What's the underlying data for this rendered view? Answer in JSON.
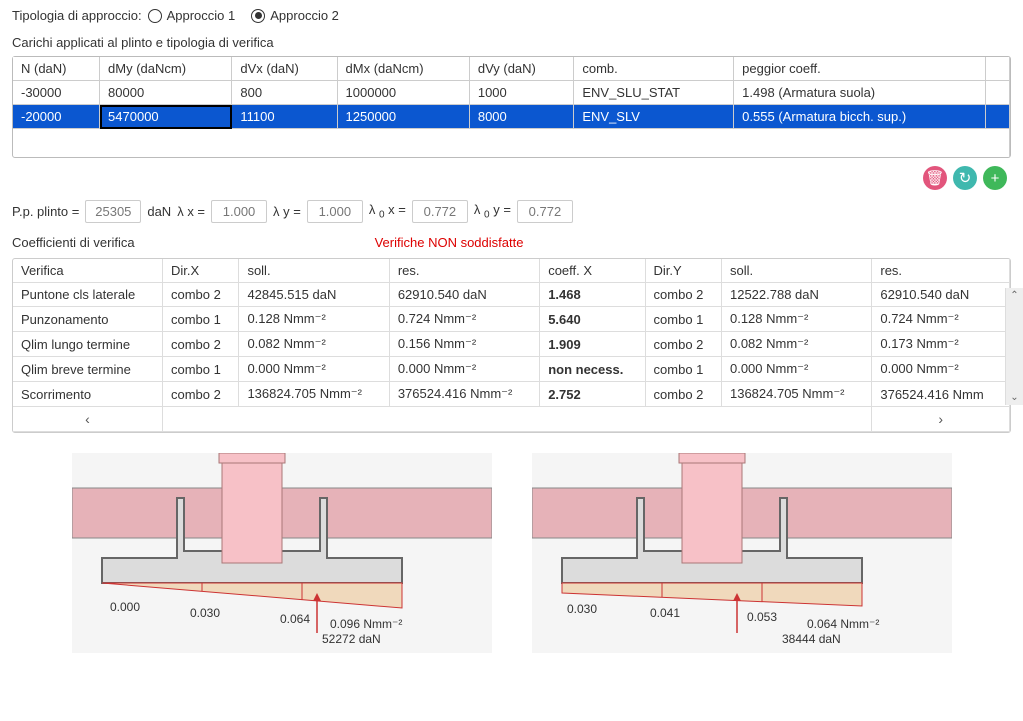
{
  "approach": {
    "label": "Tipologia di approccio:",
    "options": [
      "Approccio 1",
      "Approccio 2"
    ],
    "selected": 1
  },
  "loads_title": "Carichi applicati al plinto e tipologia di verifica",
  "loads": {
    "headers": [
      "N (daN)",
      "dMy (daNcm)",
      "dVx (daN)",
      "dMx (daNcm)",
      "dVy (daN)",
      "comb.",
      "peggior coeff."
    ],
    "rows": [
      {
        "N": "-30000",
        "dMy": "80000",
        "dVx": "800",
        "dMx": "1000000",
        "dVy": "1000",
        "comb": "ENV_SLU_STAT",
        "pc": "1.498 (Armatura suola)"
      },
      {
        "N": "-20000",
        "dMy": "5470000",
        "dVx": "11100",
        "dMx": "1250000",
        "dVy": "8000",
        "comb": "ENV_SLV",
        "pc": "0.555 (Armatura bicch. sup.)"
      }
    ]
  },
  "actions": {
    "delete": "🗑",
    "refresh": "↻",
    "add": "+"
  },
  "params": {
    "pp_label": "P.p. plinto =",
    "pp_value": "25305",
    "pp_unit": "daN",
    "lx_label": "λ x =",
    "lx": "1.000",
    "ly_label": "λ y =",
    "ly": "1.000",
    "lox_label_pre": "λ",
    "lox_label_sub": "0",
    "lox_label_post": "x =",
    "lox": "0.772",
    "loy_label_pre": "λ",
    "loy_label_sub": "0",
    "loy_label_post": "y =",
    "loy": "0.772"
  },
  "coef": {
    "title": "Coefficienti di verifica",
    "warning": "Verifiche NON soddisfatte",
    "headers": [
      "Verifica",
      "Dir.X",
      "soll.",
      "res.",
      "coeff. X",
      "Dir.Y",
      "soll.",
      "res."
    ],
    "rows": [
      {
        "v": "Puntone cls laterale",
        "dx": "combo 2",
        "sx": "42845.515 daN",
        "rx": "62910.540 daN",
        "cx": "1.468",
        "dy": "combo 2",
        "sy": "12522.788 daN",
        "ry": "62910.540 daN"
      },
      {
        "v": "Punzonamento",
        "dx": "combo 1",
        "sx": "0.128 Nmm⁻²",
        "rx": "0.724 Nmm⁻²",
        "cx": "5.640",
        "dy": "combo 1",
        "sy": "0.128 Nmm⁻²",
        "ry": "0.724 Nmm⁻²"
      },
      {
        "v": "Qlim lungo termine",
        "dx": "combo 2",
        "sx": "0.082 Nmm⁻²",
        "rx": "0.156 Nmm⁻²",
        "cx": "1.909",
        "dy": "combo 2",
        "sy": "0.082 Nmm⁻²",
        "ry": "0.173 Nmm⁻²"
      },
      {
        "v": "Qlim breve termine",
        "dx": "combo 1",
        "sx": "0.000 Nmm⁻²",
        "rx": "0.000 Nmm⁻²",
        "cx": "non necess.",
        "dy": "combo 1",
        "sy": "0.000 Nmm⁻²",
        "ry": "0.000 Nmm⁻²"
      },
      {
        "v": "Scorrimento",
        "dx": "combo 2",
        "sx": "136824.705 Nmm⁻²",
        "rx": "376524.416 Nmm⁻²",
        "cx": "2.752",
        "dy": "combo 2",
        "sy": "136824.705 Nmm⁻²",
        "ry": "376524.416 Nmm"
      }
    ],
    "scroll_left": "‹",
    "scroll_right": "›"
  },
  "diag": {
    "left": {
      "labels": [
        "0.000",
        "0.030",
        "0.064",
        "0.096 Nmm⁻²",
        "52272 daN"
      ]
    },
    "right": {
      "labels": [
        "0.030",
        "0.041",
        "0.053",
        "0.064 Nmm⁻²",
        "38444 daN"
      ]
    }
  }
}
